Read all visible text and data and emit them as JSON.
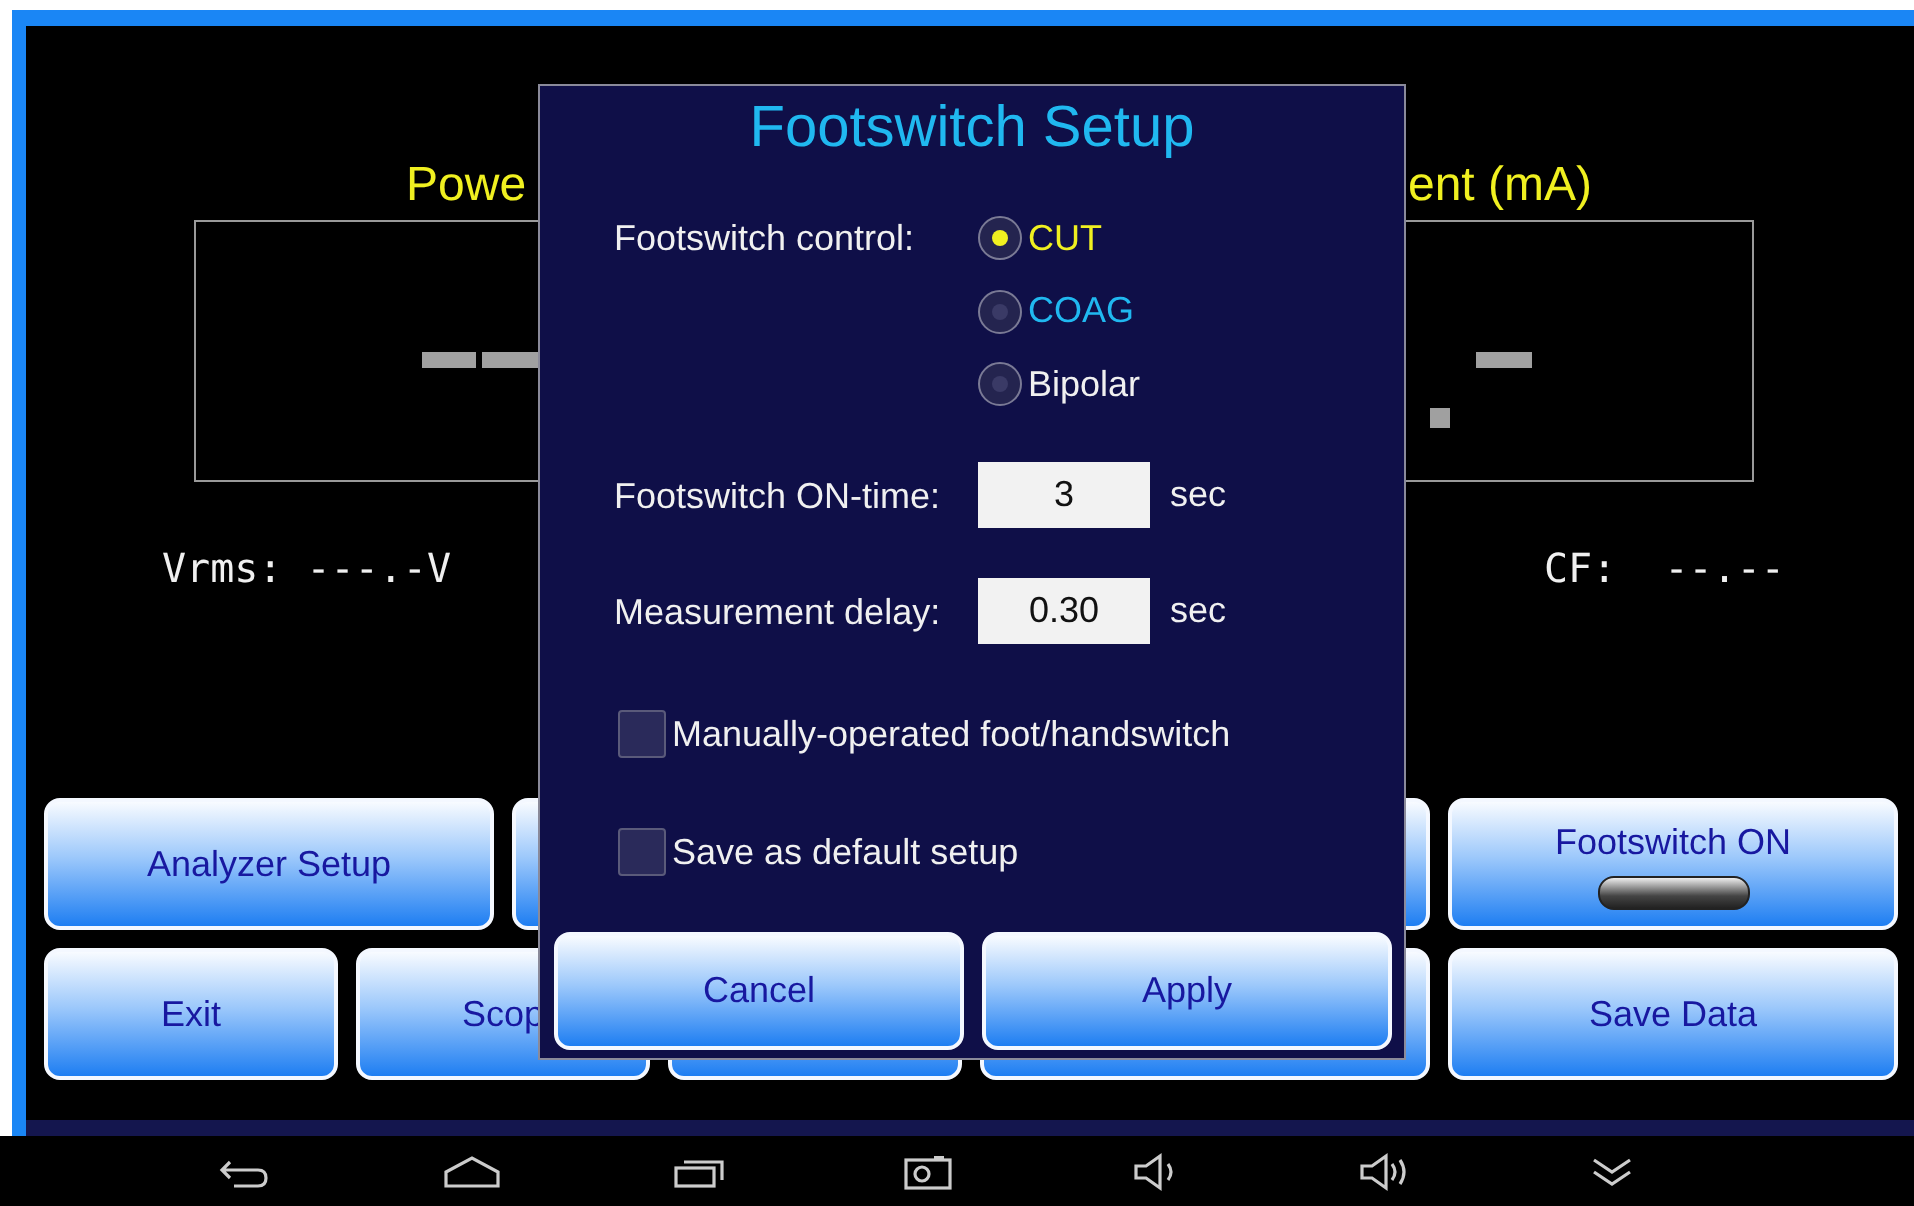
{
  "app": {
    "readouts": [
      {
        "label": "Powe"
      },
      {
        "label": "ent (mA)"
      }
    ],
    "stats": [
      "Vrms: ---.-V",
      "CF:  --.--"
    ],
    "button_rows": [
      [
        {
          "kind": "text",
          "label": "Analyzer Setup"
        },
        {
          "kind": "blank"
        },
        {
          "kind": "blank"
        },
        {
          "kind": "toggle",
          "label": "Footswitch ON",
          "on": false
        }
      ],
      [
        {
          "kind": "text",
          "label": "Exit"
        },
        {
          "kind": "text",
          "label": "Scop"
        },
        {
          "kind": "blank"
        },
        {
          "kind": "blank"
        },
        {
          "kind": "text",
          "label": "Save Data"
        }
      ]
    ]
  },
  "dialog": {
    "title": "Footswitch Setup",
    "control_label": "Footswitch control:",
    "radios": [
      {
        "label": "CUT",
        "selected": true,
        "color": "#f0f020"
      },
      {
        "label": "COAG",
        "selected": false,
        "color": "#20b8f0"
      },
      {
        "label": "Bipolar",
        "selected": false,
        "color": "#f0f0f0"
      }
    ],
    "fields": [
      {
        "label": "Footswitch ON-time:",
        "value": "3",
        "unit": "sec"
      },
      {
        "label": "Measurement delay:",
        "value": "0.30",
        "unit": "sec"
      }
    ],
    "checkboxes": [
      {
        "label": "Manually-operated foot/handswitch",
        "checked": false
      },
      {
        "label": "Save as default setup",
        "checked": false
      }
    ],
    "buttons": [
      "Cancel",
      "Apply"
    ]
  }
}
